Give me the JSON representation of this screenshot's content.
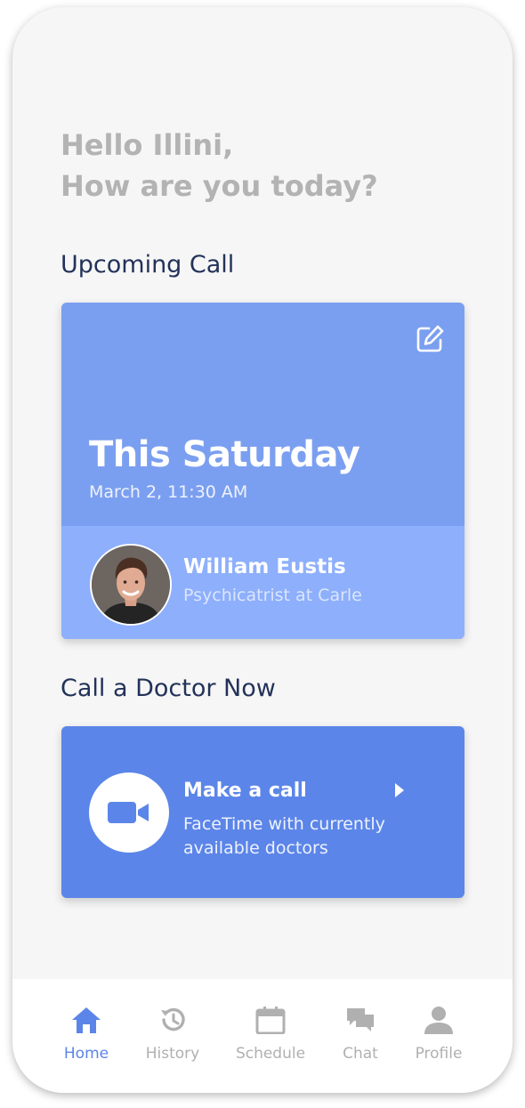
{
  "greeting": {
    "line1": "Hello Illini,",
    "line2": "How are you today?"
  },
  "upcoming": {
    "section_title": "Upcoming Call",
    "day": "This Saturday",
    "datetime": "March 2, 11:30 AM",
    "doctor_name": "William Eustis",
    "doctor_title": "Psychicatrist at Carle",
    "edit_icon": "edit-icon"
  },
  "call_now": {
    "section_title": "Call a Doctor Now",
    "label": "Make a call",
    "description": "FaceTime with currently available doctors",
    "icon": "video-camera-icon"
  },
  "tabs": [
    {
      "label": "Home",
      "icon": "home-icon",
      "active": true
    },
    {
      "label": "History",
      "icon": "history-icon",
      "active": false
    },
    {
      "label": "Schedule",
      "icon": "calendar-icon",
      "active": false
    },
    {
      "label": "Chat",
      "icon": "chat-icon",
      "active": false
    },
    {
      "label": "Profile",
      "icon": "profile-icon",
      "active": false
    }
  ],
  "colors": {
    "background": "#f6f6f6",
    "upcoming_card": "#7b9ff0",
    "doctor_row": "#8daffc",
    "make_call_card": "#5b85e8",
    "active_tab": "#5b85e8",
    "inactive_tab": "#b0b0b0",
    "greeting_text": "#b3b3b3",
    "section_title": "#23325a"
  }
}
